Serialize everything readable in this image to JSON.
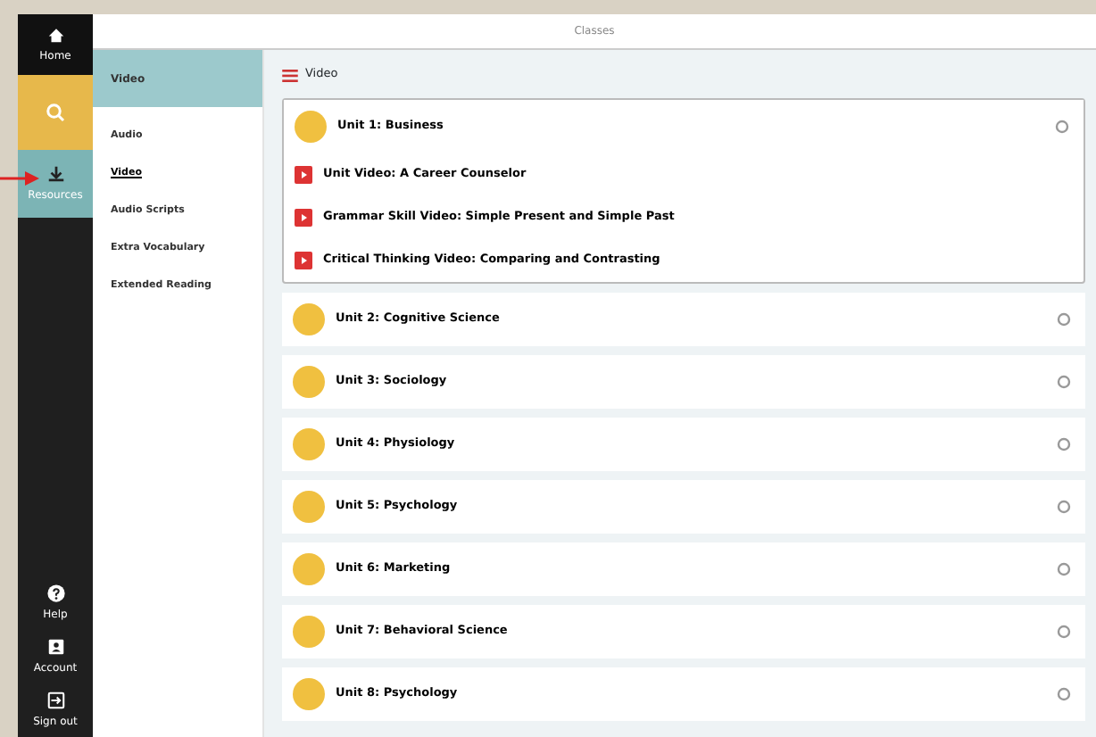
{
  "window": {
    "title": "Classes"
  },
  "sidebar": {
    "items": [
      {
        "kind": "home",
        "label": "Home",
        "selected": false
      },
      {
        "kind": "search",
        "selected": false
      },
      {
        "kind": "resources",
        "label": "Resources",
        "selected": true
      }
    ],
    "bottom_items": [
      {
        "kind": "help",
        "label": "Help"
      },
      {
        "kind": "account",
        "label": "Account"
      },
      {
        "kind": "signout",
        "label": "Sign out"
      }
    ]
  },
  "submenu": {
    "heading": "Video",
    "items": [
      {
        "label": "Audio",
        "selected": false
      },
      {
        "label": "Video",
        "selected": true
      },
      {
        "label": "Audio Scripts",
        "selected": false
      },
      {
        "label": "Extra Vocabulary",
        "selected": false
      },
      {
        "label": "Extended Reading",
        "selected": false
      }
    ]
  },
  "content": {
    "heading": "Video",
    "units": [
      {
        "title": "Unit 1: Business",
        "expanded": true,
        "children": [
          {
            "title": "Unit Video: A Career Counselor"
          },
          {
            "title": "Grammar Skill Video: Simple Present and Simple Past"
          },
          {
            "title": "Critical Thinking Video: Comparing and Contrasting"
          }
        ]
      },
      {
        "title": "Unit 2: Cognitive Science",
        "expanded": false
      },
      {
        "title": "Unit 3: Sociology",
        "expanded": false
      },
      {
        "title": "Unit 4: Physiology",
        "expanded": false
      },
      {
        "title": "Unit 5: Psychology",
        "expanded": false
      },
      {
        "title": "Unit 6: Marketing",
        "expanded": false
      },
      {
        "title": "Unit 7: Behavioral Science",
        "expanded": false
      },
      {
        "title": "Unit 8: Psychology",
        "expanded": false
      }
    ]
  }
}
